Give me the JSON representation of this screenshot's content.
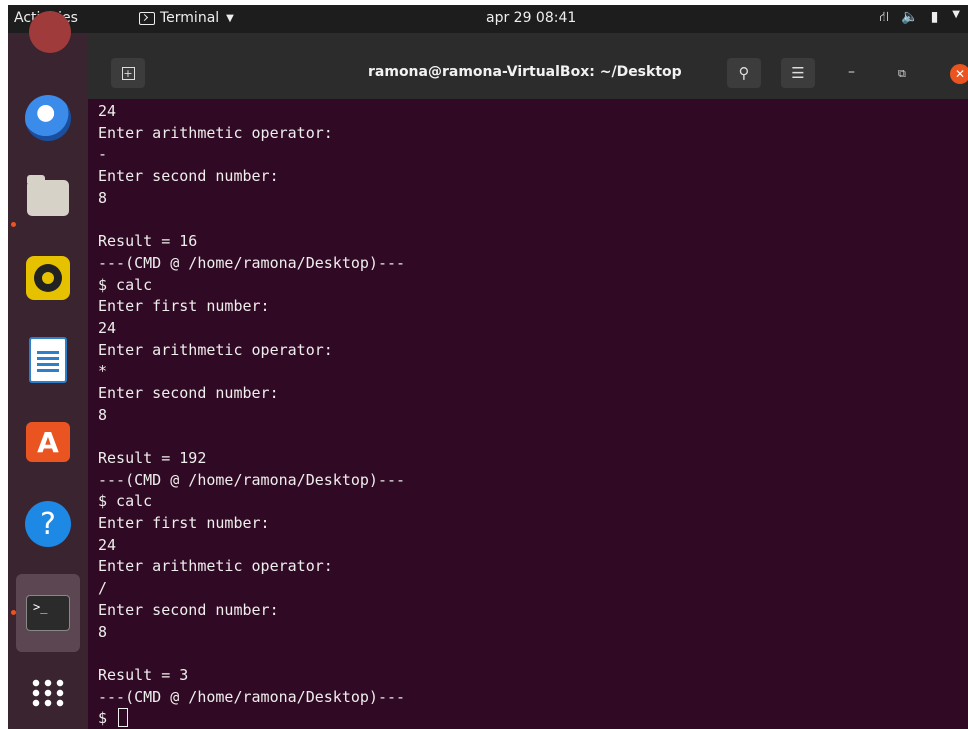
{
  "topbar": {
    "activities": "Activities",
    "app_name": "Terminal",
    "clock": "apr 29  08:41"
  },
  "dock": {
    "items": [
      {
        "icon": "thunderbird-icon"
      },
      {
        "icon": "files-icon",
        "running": true
      },
      {
        "icon": "rhythmbox-icon"
      },
      {
        "icon": "libreoffice-writer-icon"
      },
      {
        "icon": "ubuntu-software-icon"
      },
      {
        "icon": "help-icon"
      },
      {
        "icon": "terminal-icon",
        "running": true,
        "active": true
      },
      {
        "icon": "show-applications-icon"
      }
    ]
  },
  "window": {
    "title": "ramona@ramona-VirtualBox: ~/Desktop"
  },
  "terminal": {
    "lines": [
      "24",
      "Enter arithmetic operator:",
      "-",
      "Enter second number:",
      "8",
      "",
      "Result = 16",
      "---(CMD @ /home/ramona/Desktop)---",
      "$ calc",
      "Enter first number:",
      "24",
      "Enter arithmetic operator:",
      "*",
      "Enter second number:",
      "8",
      "",
      "Result = 192",
      "---(CMD @ /home/ramona/Desktop)---",
      "$ calc",
      "Enter first number:",
      "24",
      "Enter arithmetic operator:",
      "/",
      "Enter second number:",
      "8",
      "",
      "Result = 3",
      "---(CMD @ /home/ramona/Desktop)---"
    ],
    "prompt": "$ "
  },
  "colors": {
    "terminal_bg": "#300a24",
    "accent": "#e95420",
    "text": "#eeeeec"
  }
}
